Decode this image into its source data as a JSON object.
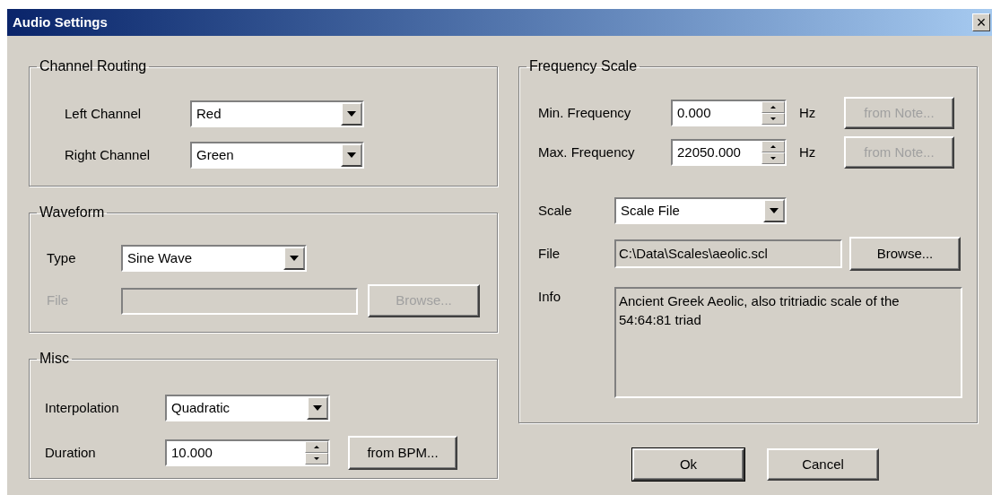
{
  "window": {
    "title": "Audio Settings",
    "close": "×"
  },
  "channel_routing": {
    "title": "Channel Routing",
    "rows": [
      {
        "label": "Left Channel",
        "value": "Red"
      },
      {
        "label": "Right Channel",
        "value": "Green"
      }
    ]
  },
  "waveform": {
    "title": "Waveform",
    "type": {
      "label": "Type",
      "value": "Sine Wave"
    },
    "file": {
      "label": "File",
      "disabled": true
    },
    "browse_button": {
      "label": "Browse...",
      "disabled": true
    }
  },
  "misc": {
    "title": "Misc",
    "interpolation": {
      "label": "Interpolation",
      "value": "Quadratic"
    },
    "duration": {
      "label": "Duration",
      "value": "10.000"
    },
    "bpm_button": {
      "label": "from BPM...",
      "disabled": false
    }
  },
  "frequency_scale": {
    "title": "Frequency Scale",
    "rows": [
      {
        "label": "Min. Frequency",
        "value": "0.000",
        "unit": "Hz",
        "button": "from Note...",
        "disabled": true
      },
      {
        "label": "Max. Frequency",
        "value": "22050.000",
        "unit": "Hz",
        "button": "from Note...",
        "disabled": true
      }
    ],
    "scale": {
      "label": "Scale",
      "value": "Scale File"
    },
    "file": {
      "label": "File",
      "value": "C:\\Data\\Scales\\aeolic.scl"
    },
    "browse_button": {
      "label": "Browse...",
      "disabled": false
    },
    "info": {
      "label": "Info",
      "value": "Ancient Greek Aeolic, also tritriadic scale of the 54:64:81 triad"
    }
  },
  "buttons": [
    {
      "label": "Ok",
      "default": true
    },
    {
      "label": "Cancel",
      "default": false
    }
  ]
}
